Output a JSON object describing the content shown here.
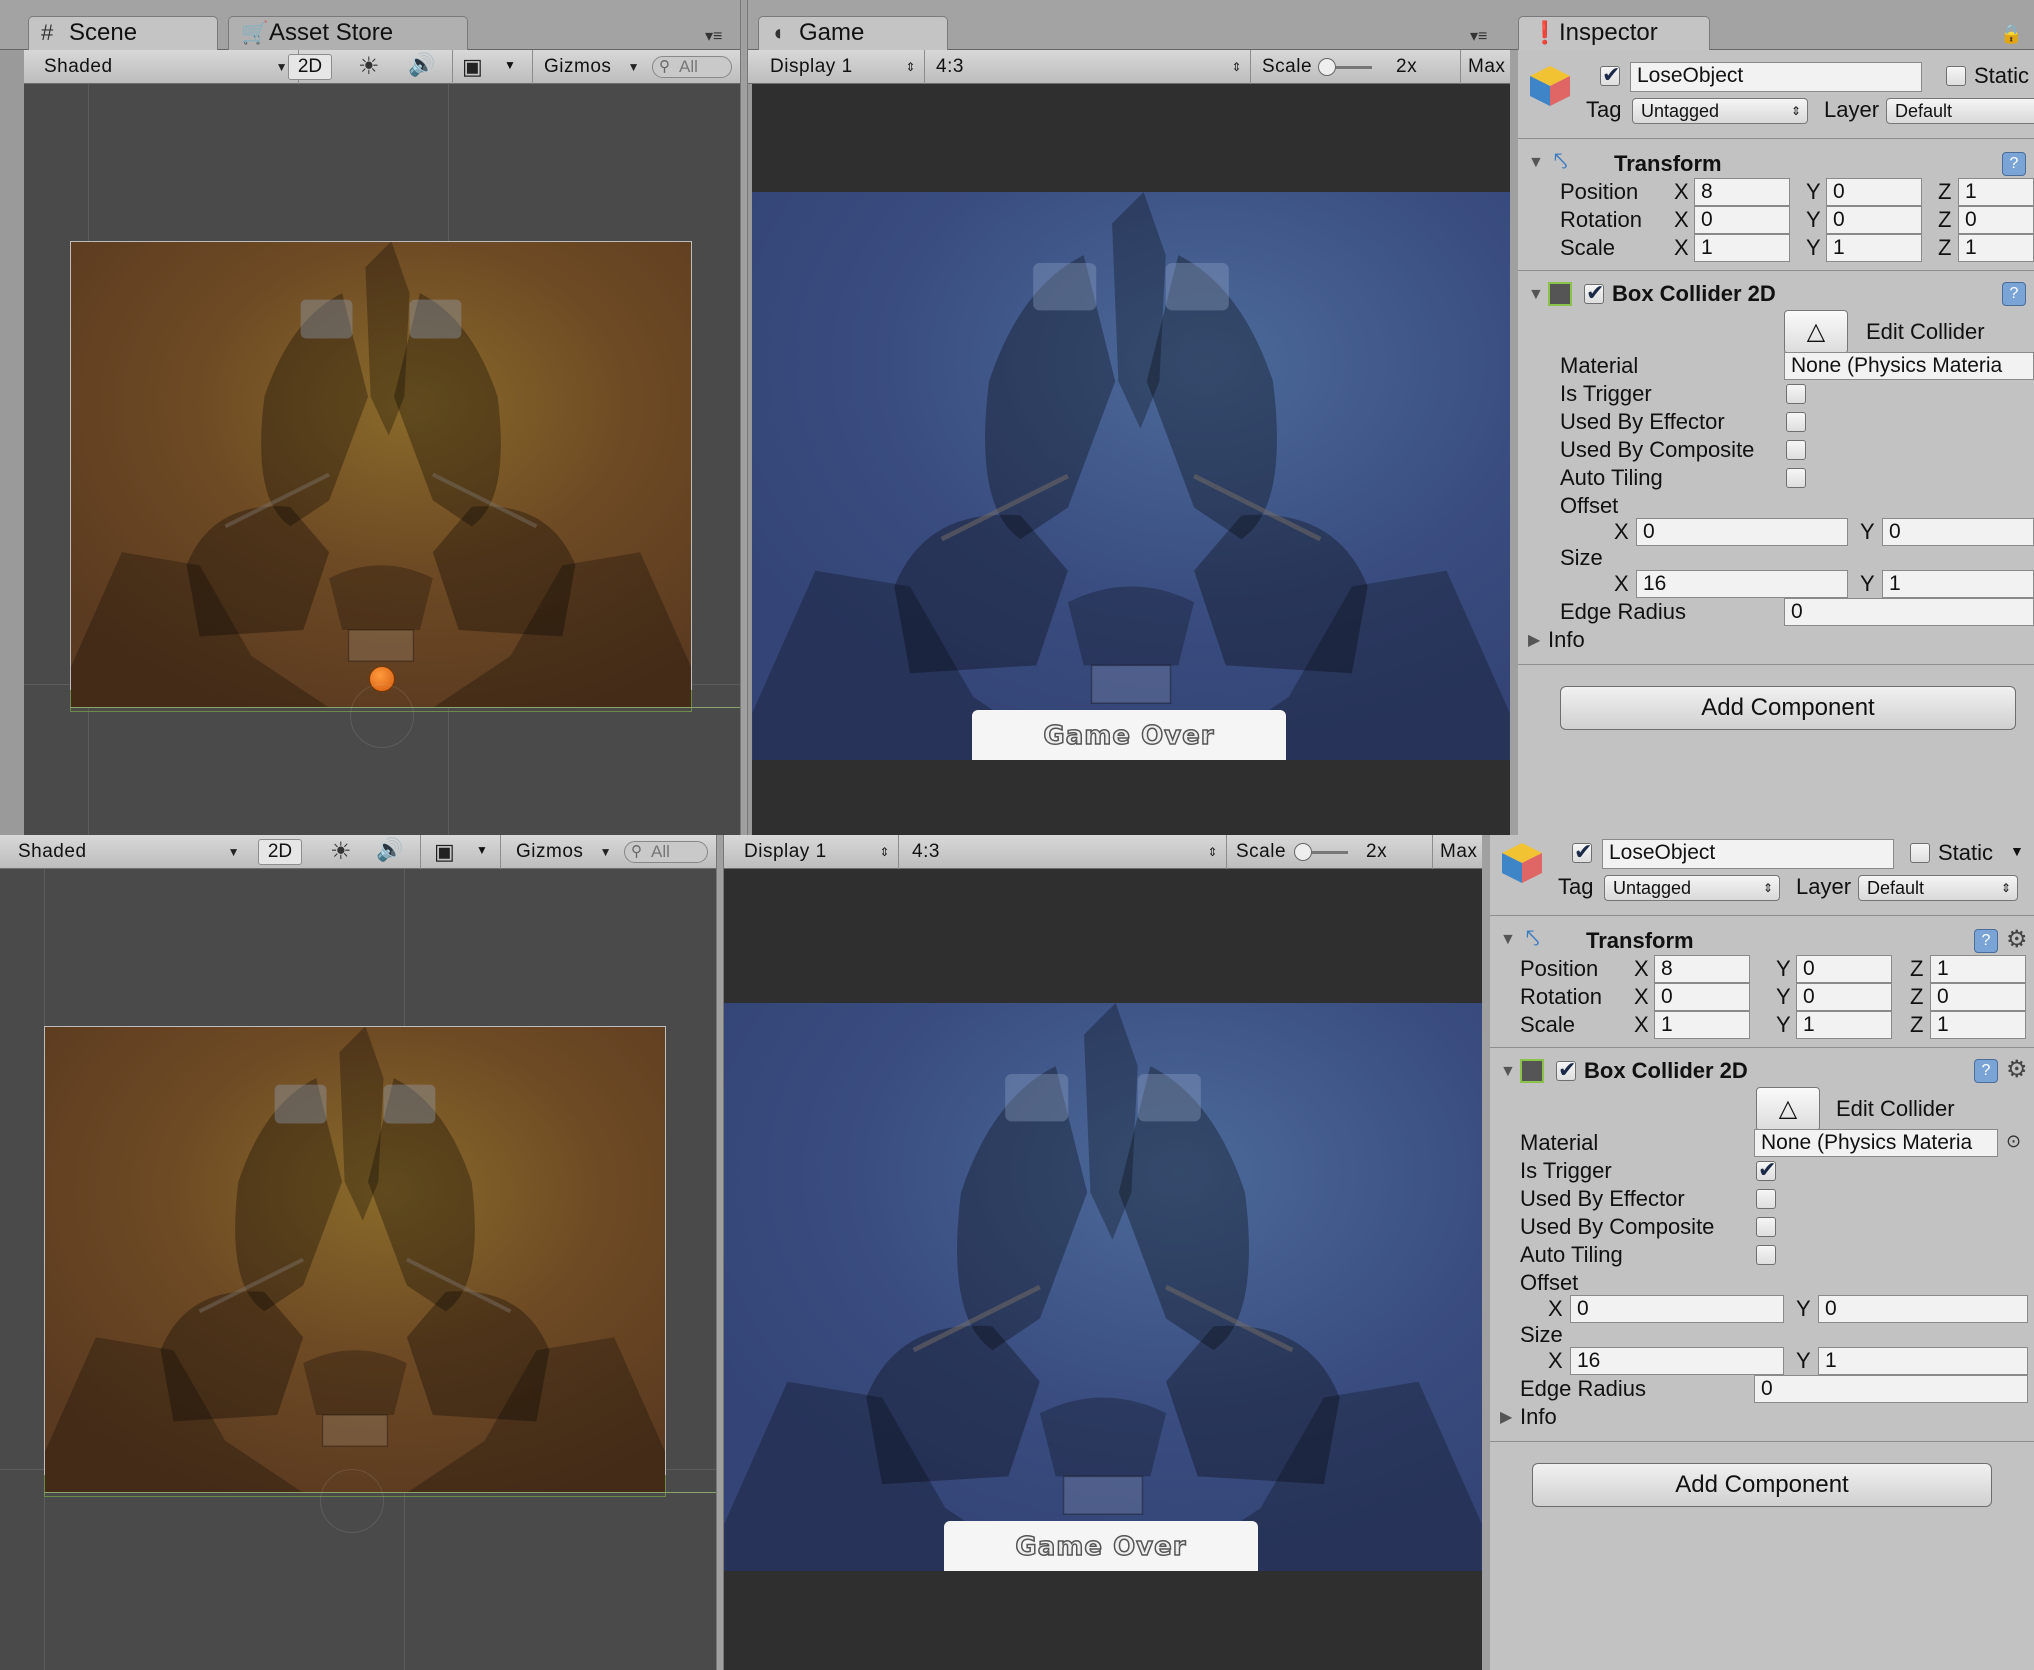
{
  "top": {
    "tabs": {
      "scene": "Scene",
      "asset_store": "Asset Store",
      "game": "Game",
      "inspector": "Inspector"
    },
    "scene_toolbar": {
      "shading": "Shaded",
      "mode_2d": "2D",
      "gizmos": "Gizmos",
      "search_placeholder": "All"
    },
    "game_toolbar": {
      "display": "Display 1",
      "aspect": "4:3",
      "scale_label": "Scale",
      "scale_value": "2x",
      "maximize": "Max"
    },
    "game_overlay": {
      "button_text": "Game Over"
    },
    "inspector": {
      "object_name": "LoseObject",
      "static_label": "Static",
      "tag_label": "Tag",
      "tag_value": "Untagged",
      "layer_label": "Layer",
      "layer_value": "Default",
      "transform": {
        "title": "Transform",
        "position": {
          "label": "Position",
          "x": "8",
          "y": "0",
          "z": "1"
        },
        "rotation": {
          "label": "Rotation",
          "x": "0",
          "y": "0",
          "z": "0"
        },
        "scale": {
          "label": "Scale",
          "x": "1",
          "y": "1",
          "z": "1"
        }
      },
      "box_collider": {
        "title": "Box Collider 2D",
        "edit_collider": "Edit Collider",
        "material_label": "Material",
        "material_value": "None (Physics Materia",
        "is_trigger": "Is Trigger",
        "is_trigger_checked": false,
        "used_by_effector": "Used By Effector",
        "used_by_composite": "Used By Composite",
        "auto_tiling": "Auto Tiling",
        "offset_label": "Offset",
        "offset_x": "0",
        "offset_y": "0",
        "size_label": "Size",
        "size_x": "16",
        "size_y": "1",
        "edge_radius_label": "Edge Radius",
        "edge_radius": "0",
        "info_label": "Info"
      },
      "add_component": "Add Component"
    }
  },
  "bottom": {
    "scene_toolbar": {
      "shading": "Shaded",
      "mode_2d": "2D",
      "gizmos": "Gizmos",
      "search_placeholder": "All"
    },
    "game_toolbar": {
      "display": "Display 1",
      "aspect": "4:3",
      "scale_label": "Scale",
      "scale_value": "2x",
      "maximize": "Max"
    },
    "game_overlay": {
      "button_text": "Game Over"
    },
    "inspector": {
      "object_name": "LoseObject",
      "static_label": "Static",
      "tag_label": "Tag",
      "tag_value": "Untagged",
      "layer_label": "Layer",
      "layer_value": "Default",
      "transform": {
        "title": "Transform",
        "position": {
          "label": "Position",
          "x": "8",
          "y": "0",
          "z": "1"
        },
        "rotation": {
          "label": "Rotation",
          "x": "0",
          "y": "0",
          "z": "0"
        },
        "scale": {
          "label": "Scale",
          "x": "1",
          "y": "1",
          "z": "1"
        }
      },
      "box_collider": {
        "title": "Box Collider 2D",
        "edit_collider": "Edit Collider",
        "material_label": "Material",
        "material_value": "None (Physics Materia",
        "is_trigger": "Is Trigger",
        "is_trigger_checked": true,
        "used_by_effector": "Used By Effector",
        "used_by_composite": "Used By Composite",
        "auto_tiling": "Auto Tiling",
        "offset_label": "Offset",
        "offset_x": "0",
        "offset_y": "0",
        "size_label": "Size",
        "size_x": "16",
        "size_y": "1",
        "edge_radius_label": "Edge Radius",
        "edge_radius": "0",
        "info_label": "Info"
      },
      "add_component": "Add Component"
    }
  },
  "colors": {
    "scene_bg": "#4a4a4a",
    "game_tint": "#3c4e80",
    "inspector_bg": "#c2c2c2",
    "accent_ball": "#e06a14"
  }
}
